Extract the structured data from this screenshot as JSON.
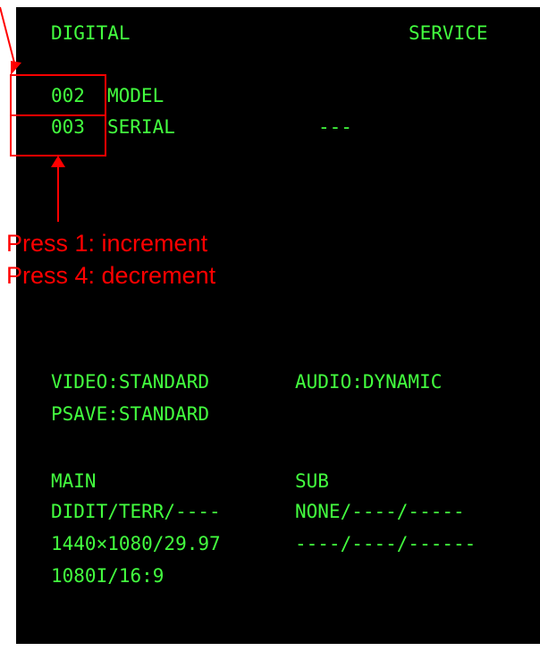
{
  "header": {
    "left": "DIGITAL",
    "right": "SERVICE"
  },
  "items": [
    {
      "code": "002",
      "label": "MODEL",
      "value": ""
    },
    {
      "code": "003",
      "label": "SERIAL",
      "value": "---"
    }
  ],
  "annotation": {
    "line1": "Press 1: increment",
    "line2": "Press 4: decrement",
    "color": "#ff0000"
  },
  "status": {
    "video": "VIDEO:STANDARD",
    "audio": "AUDIO:DYNAMIC",
    "psave": "PSAVE:STANDARD"
  },
  "sources": {
    "main_title": "MAIN",
    "sub_title": "SUB",
    "main_lines": [
      "DIDIT/TERR/----",
      "1440×1080/29.97",
      "1080I/16:9"
    ],
    "sub_lines": [
      "NONE/----/-----",
      "----/----/------"
    ]
  },
  "colors": {
    "text": "#43ff3f",
    "background": "#000000",
    "highlight": "#ff0000"
  }
}
